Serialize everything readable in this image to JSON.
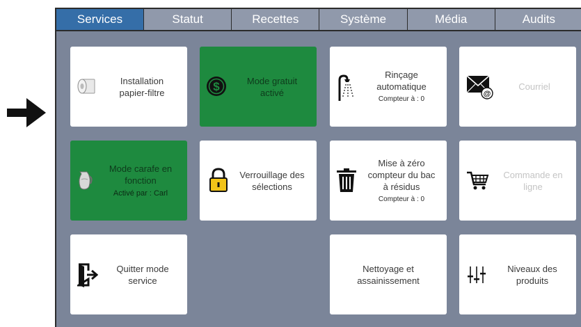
{
  "tabs": [
    "Services",
    "Statut",
    "Recettes",
    "Système",
    "Média",
    "Audits"
  ],
  "active_tab": "Services",
  "colors": {
    "active_tab": "#356ea8",
    "tab_bar": "#9099ab",
    "panel_bg": "#7b8599",
    "tile_bg": "#ffffff",
    "tile_active_green": "#1e8a3f",
    "disabled_text": "#c4c4c4",
    "lock_yellow": "#f2c318"
  },
  "pointer": {
    "icon": "right-arrow-icon"
  },
  "tiles": {
    "filter": {
      "line1": "Installation",
      "line2": "papier-filtre",
      "icon": "filter-paper-roll-icon",
      "state": "normal"
    },
    "free": {
      "line1": "Mode gratuit",
      "line2": "activé",
      "icon": "dollar-coin-icon",
      "state": "active"
    },
    "rinse": {
      "line1": "Rinçage",
      "line2": "automatique",
      "sub": "Compteur à : 0",
      "icon": "shower-icon",
      "state": "normal"
    },
    "mail": {
      "line1": "Courriel",
      "icon": "mail-icon",
      "state": "disabled"
    },
    "carafe": {
      "line1": "Mode carafe en",
      "line2": "fonction",
      "sub": "Activé par : Carl",
      "icon": "carafe-icon",
      "state": "active"
    },
    "lock": {
      "line1": "Verrouillage des",
      "line2": "sélections",
      "icon": "padlock-icon",
      "state": "normal"
    },
    "waste": {
      "line1": "Mise à zéro",
      "line2": "compteur du bac",
      "line3": "à résidus",
      "sub": "Compteur à : 0",
      "icon": "trash-bin-icon",
      "state": "normal"
    },
    "order": {
      "line1": "Commande en",
      "line2": "ligne",
      "icon": "shopping-cart-icon",
      "state": "disabled"
    },
    "exit": {
      "line1": "Quitter mode",
      "line2": "service",
      "icon": "exit-door-icon",
      "state": "normal"
    },
    "clean": {
      "line1": "Nettoyage et",
      "line2": "assainissement",
      "state": "normal"
    },
    "levels": {
      "line1": "Niveaux des",
      "line2": "produits",
      "icon": "level-sliders-icon",
      "state": "normal"
    }
  }
}
